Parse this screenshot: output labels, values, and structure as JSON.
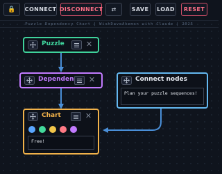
{
  "toolbar": {
    "lock_icon": "lock-icon",
    "connect": "CONNECT",
    "disconnect": "DISCONNECT",
    "swap_glyph": "⇄",
    "save": "SAVE",
    "load": "LOAD",
    "reset": "RESET",
    "danger_color": "#ff6f86"
  },
  "subtitle": "Puzzle Dependency Chart  |  WishDaveAkemon with Claude  |  2025",
  "nodes": {
    "puzzle": {
      "title": "Puzzle",
      "color": "#3fd29b"
    },
    "dependency": {
      "title": "Dependency",
      "color": "#c27bff"
    },
    "connect_nodes": {
      "title": "Connect nodes",
      "color": "#64b8f0",
      "text": "Plan your puzzle sequences!"
    },
    "chart": {
      "title": "Chart",
      "color": "#f2b24a",
      "text": "Free!",
      "swatches": [
        "#5aa6ff",
        "#43d99b",
        "#f2c64a",
        "#ff7a85",
        "#c27bff"
      ]
    }
  },
  "wire_color": "#4a8fd8"
}
